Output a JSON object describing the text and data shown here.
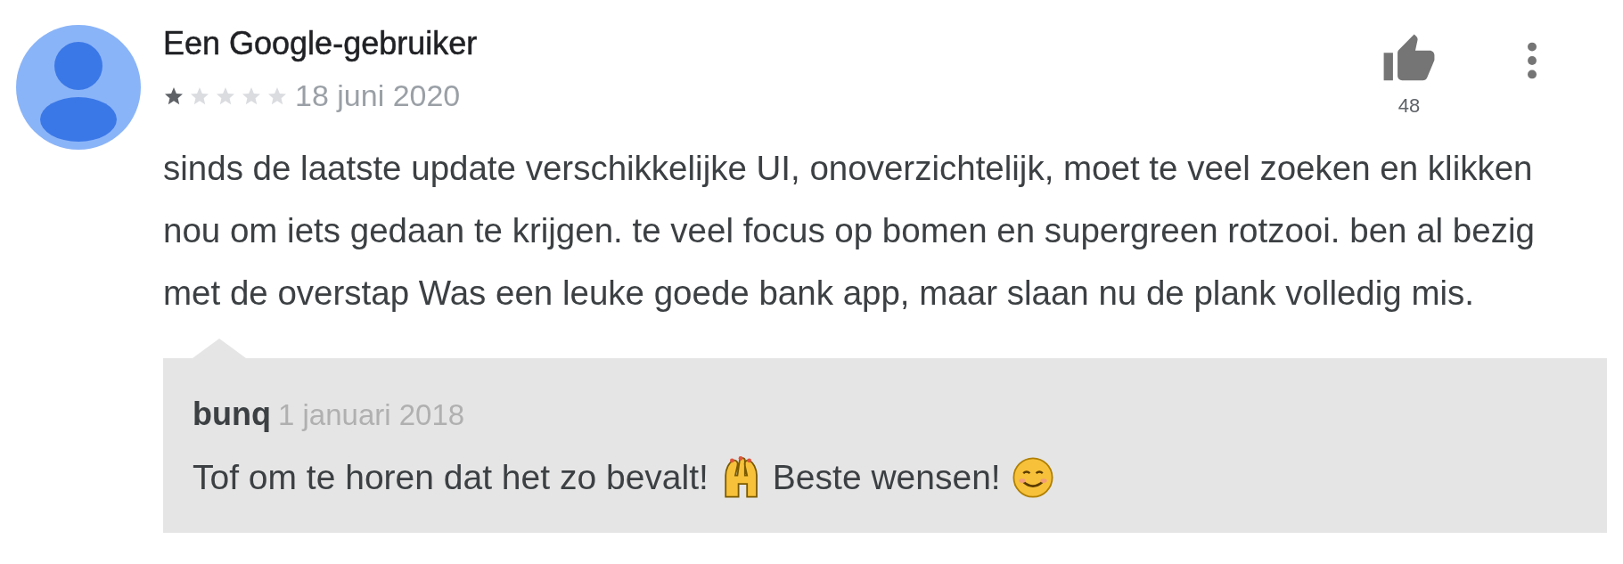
{
  "review": {
    "author": "Een Google-gebruiker",
    "stars": 1,
    "date": "18 juni 2020",
    "likes": "48",
    "text": "sinds de laatste update verschikkelijke UI, onoverzichtelijk, moet te veel zoeken en klikken nou om iets gedaan te krijgen. te veel focus op bomen en supergreen rotzooi. ben al bezig met de overstap Was een leuke goede bank app, maar slaan nu de plank volledig mis."
  },
  "reply": {
    "author": "bunq",
    "date": "1 januari 2018",
    "text_parts": [
      "Tof om te horen dat het zo bevalt!",
      "Beste wensen!"
    ]
  }
}
